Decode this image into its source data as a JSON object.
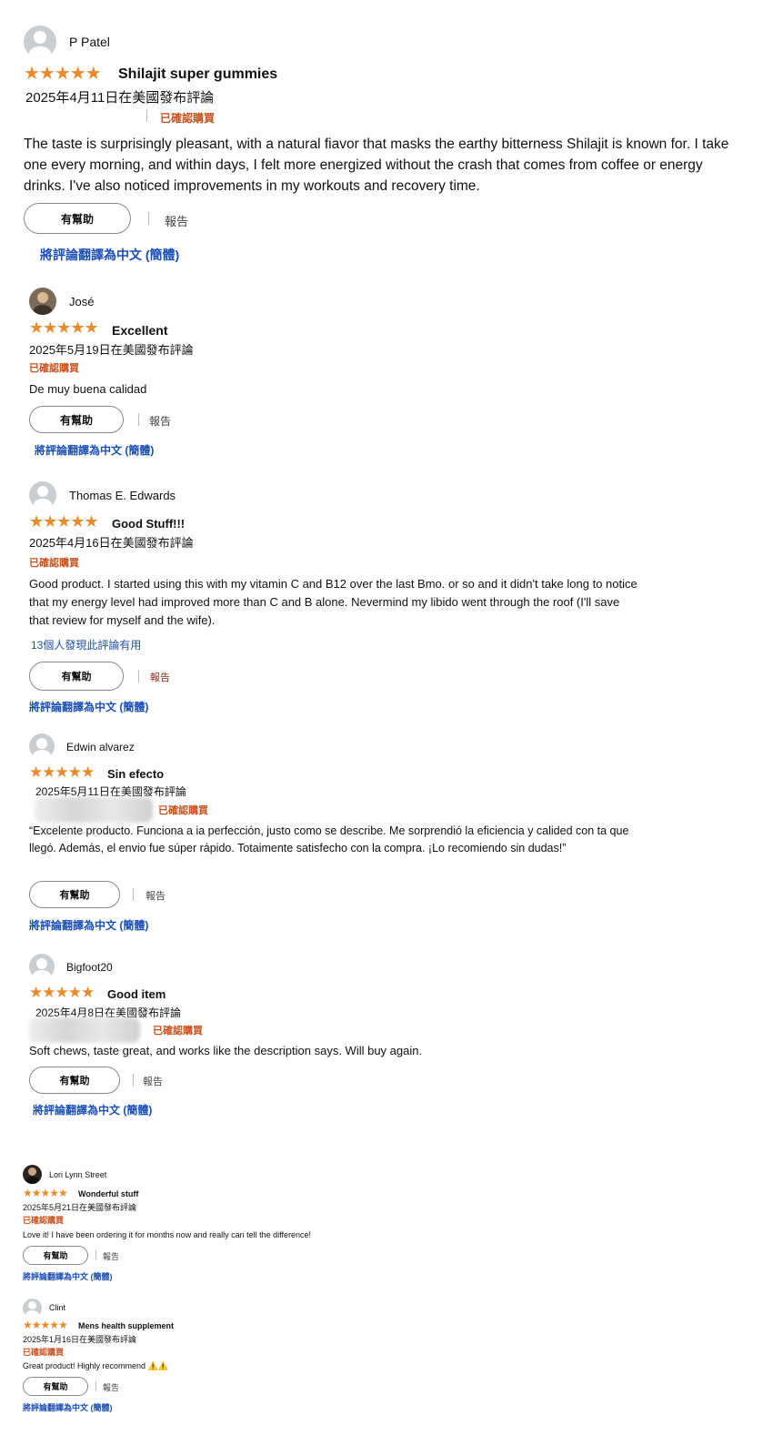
{
  "reviews": [
    {
      "name": "P Patel",
      "stars": "★★★★★",
      "title": "Shilajit super gummies",
      "date": "2025年4月11日在美國發布評論",
      "verified": "已確認購買",
      "body": "The taste is surprisingly pleasant, with a natural fiavor that masks the earthy bitterness Shilajit is known for. I take one every morning, and within days, I felt more energized without the crash that comes from coffee or energy drinks. I've also noticed improvements in my workouts and recovery time.",
      "helpful": "有幫助",
      "report": "報告",
      "translate": "將評論翻譯為中文 (簡體)"
    },
    {
      "name": "José",
      "stars": "★★★★★",
      "title": "Excellent",
      "date": "2025年5月19日在美國發布評論",
      "verified": "已確認購買",
      "body": "De muy buena calidad",
      "helpful": "有幫助",
      "report": "報告",
      "translate": "將評論翻譯為中文 (簡體)"
    },
    {
      "name": "Thomas E. Edwards",
      "stars": "★★★★★",
      "title": "Good Stuff!!!",
      "date": "2025年4月16日在美國發布評論",
      "verified": "已確認購買",
      "body": "Good product. I started using this with my vitamin C and B12 over the last Bmo. or so and it didn't take long to notice that my energy level had improved more than C and B alone. Nevermind my libido went through the roof (I'll save that review for myself and the wife).",
      "found_helpful": "13個人發現此評論有用",
      "helpful": "有幫助",
      "report": "報告",
      "translate": "將評論翻譯為中文 (簡體)"
    },
    {
      "name": "Edwin alvarez",
      "stars": "★★★★★",
      "title": "Sin efecto",
      "date": "2025年5月11日在美國發布評論",
      "verified": "已確認購買",
      "body": "“Excelente producto. Funciona a ia perfección, justo como se describe. Me sorprendió la eficiencia y calided con ta que llegó. Además, el envio fue súper rápido. Totaimente satisfecho con la compra. ¡Lo recomiendo sin dudas!”",
      "helpful": "有幫助",
      "report": "報告",
      "translate": "將評論翻譯為中文 (簡體)"
    },
    {
      "name": "Bigfoot20",
      "stars": "★★★★★",
      "title": "Good item",
      "date": "2025年4月8日在美國發布評論",
      "verified": "已確認購買",
      "body": "Soft chews, taste great, and works like the description says. Will buy again.",
      "helpful": "有幫助",
      "report": "報告",
      "translate": "將評論翻譯為中文 (簡體)"
    },
    {
      "name": "Lori Lynn Street",
      "stars": "★★★★★",
      "title": "Wonderful stuff",
      "date": "2025年5月21日在美國發布評論",
      "verified": "已確認購買",
      "body": "Love it! I have been ordering it for months now and really can tell the difference!",
      "helpful": "有幫助",
      "report": "報告",
      "translate": "將評論翻譯為中文 (簡體)"
    },
    {
      "name": "Clint",
      "stars": "★★★★★",
      "title": "Mens health supplement",
      "date": "2025年1月16日在美國發布評論",
      "verified": "已確認購買",
      "body": "Great product! Highly recommend ⚠️⚠️",
      "helpful": "有幫助",
      "report": "報告",
      "translate": "將評論翻譯為中文 (簡體)"
    }
  ],
  "colors": {
    "star": "#e88b2d",
    "verified": "#c7511f",
    "link": "#1a4fb8"
  }
}
